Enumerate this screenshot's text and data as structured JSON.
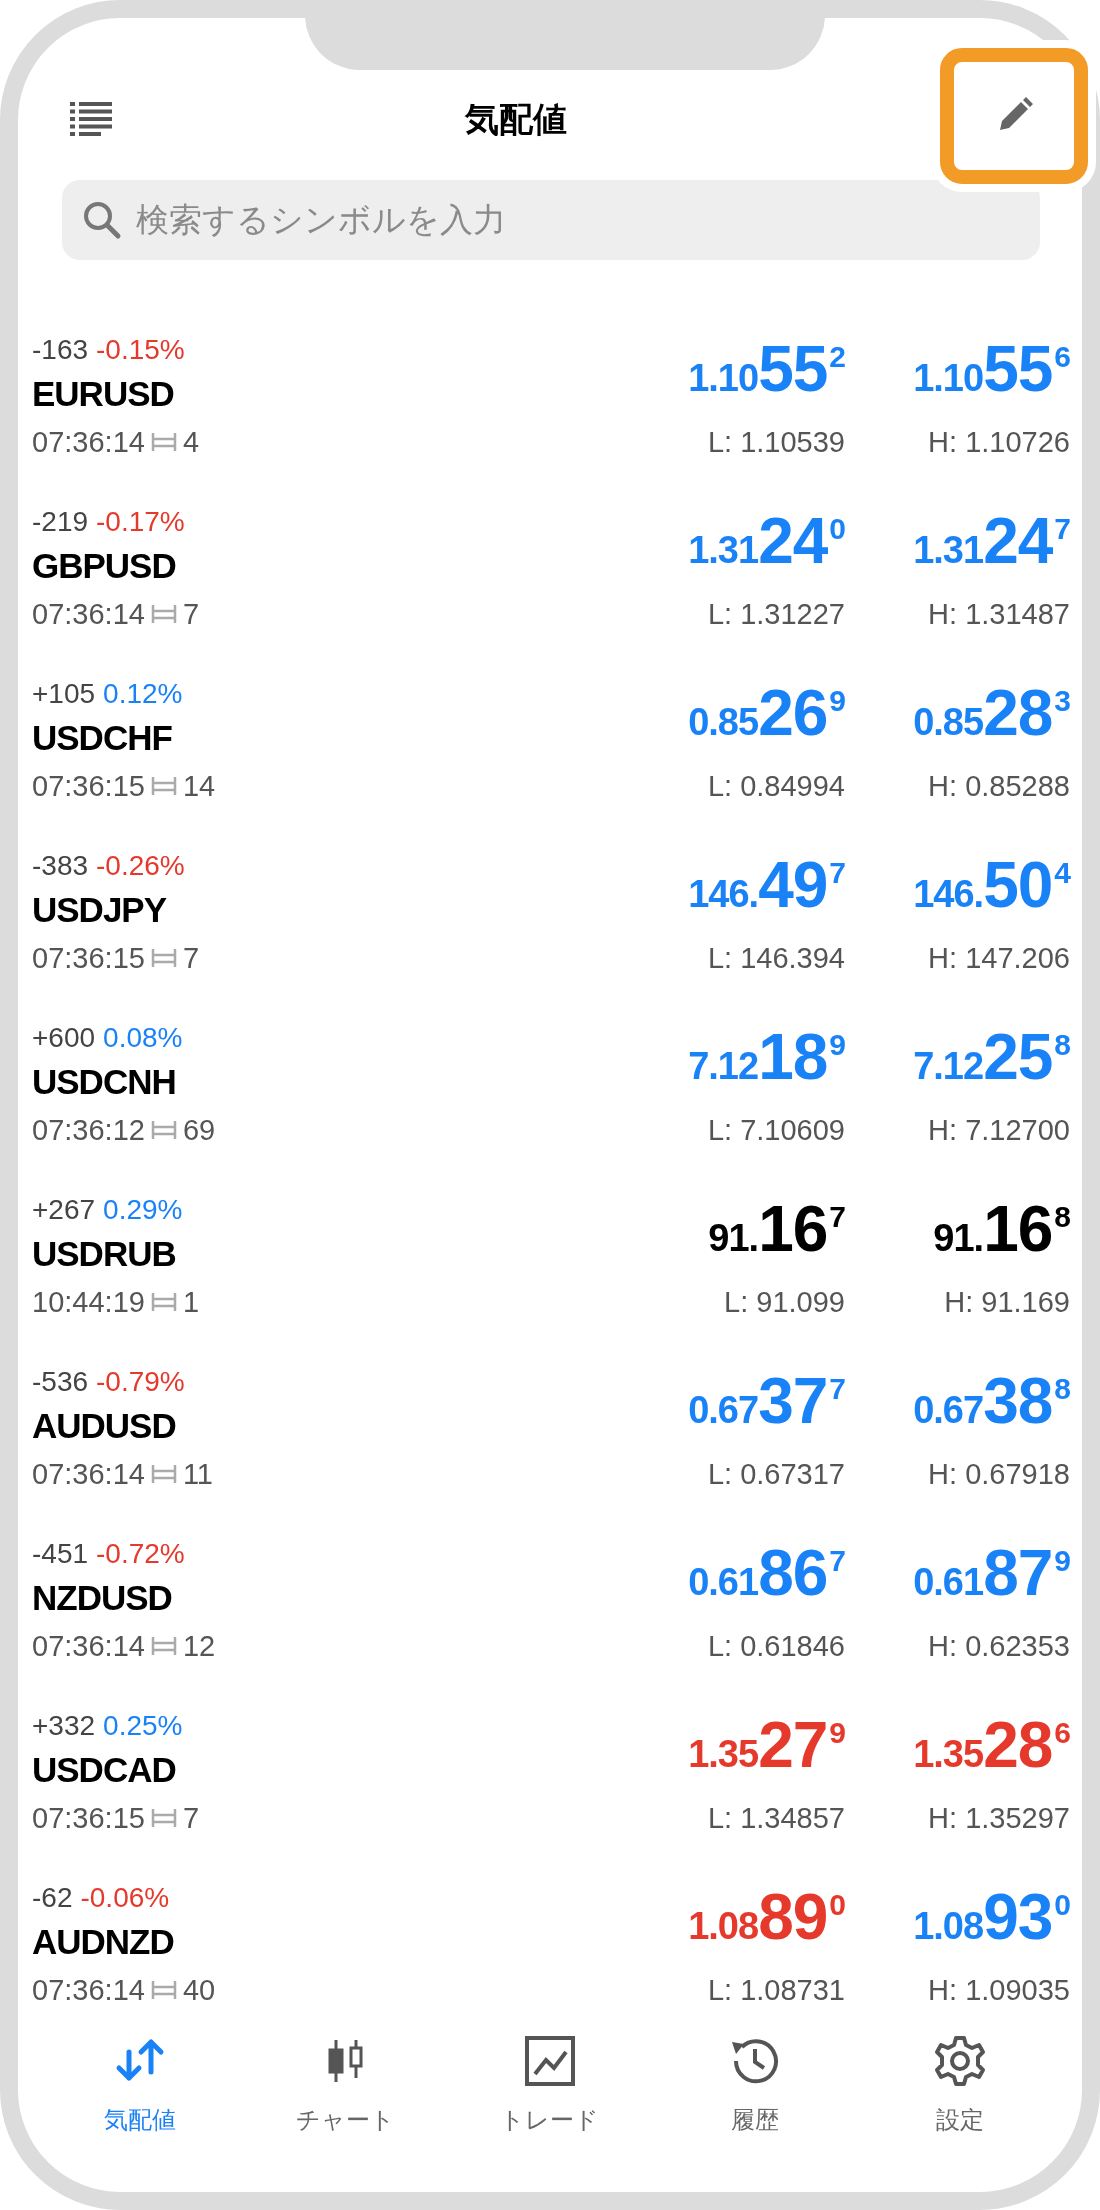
{
  "header": {
    "title": "気配値",
    "edit_button": {
      "highlighted": true
    }
  },
  "search": {
    "placeholder": "検索するシンボルを入力"
  },
  "quotes": [
    {
      "points": "-163",
      "percent": "-0.15%",
      "color": "#e5392c",
      "symbol": "EURUSD",
      "time": "07:36:14",
      "spread": "4",
      "bid": {
        "prefix": "1.10",
        "big": "55",
        "sup": "2",
        "color": "#1a82f7"
      },
      "ask": {
        "prefix": "1.10",
        "big": "55",
        "sup": "6",
        "color": "#1a82f7"
      },
      "low": "L: 1.10539",
      "high": "H: 1.10726"
    },
    {
      "points": "-219",
      "percent": "-0.17%",
      "color": "#e5392c",
      "symbol": "GBPUSD",
      "time": "07:36:14",
      "spread": "7",
      "bid": {
        "prefix": "1.31",
        "big": "24",
        "sup": "0",
        "color": "#1a82f7"
      },
      "ask": {
        "prefix": "1.31",
        "big": "24",
        "sup": "7",
        "color": "#1a82f7"
      },
      "low": "L: 1.31227",
      "high": "H: 1.31487"
    },
    {
      "points": "+105",
      "percent": "0.12%",
      "color": "#1a82f7",
      "symbol": "USDCHF",
      "time": "07:36:15",
      "spread": "14",
      "bid": {
        "prefix": "0.85",
        "big": "26",
        "sup": "9",
        "color": "#1a82f7"
      },
      "ask": {
        "prefix": "0.85",
        "big": "28",
        "sup": "3",
        "color": "#1a82f7"
      },
      "low": "L: 0.84994",
      "high": "H: 0.85288"
    },
    {
      "points": "-383",
      "percent": "-0.26%",
      "color": "#e5392c",
      "symbol": "USDJPY",
      "time": "07:36:15",
      "spread": "7",
      "bid": {
        "prefix": "146.",
        "big": "49",
        "sup": "7",
        "color": "#1a82f7"
      },
      "ask": {
        "prefix": "146.",
        "big": "50",
        "sup": "4",
        "color": "#1a82f7"
      },
      "low": "L: 146.394",
      "high": "H: 147.206"
    },
    {
      "points": "+600",
      "percent": "0.08%",
      "color": "#1a82f7",
      "symbol": "USDCNH",
      "time": "07:36:12",
      "spread": "69",
      "bid": {
        "prefix": "7.12",
        "big": "18",
        "sup": "9",
        "color": "#1a82f7"
      },
      "ask": {
        "prefix": "7.12",
        "big": "25",
        "sup": "8",
        "color": "#1a82f7"
      },
      "low": "L: 7.10609",
      "high": "H: 7.12700"
    },
    {
      "points": "+267",
      "percent": "0.29%",
      "color": "#1a82f7",
      "symbol": "USDRUB",
      "time": "10:44:19",
      "spread": "1",
      "bid": {
        "prefix": "91.",
        "big": "16",
        "sup": "7",
        "color": "#000000"
      },
      "ask": {
        "prefix": "91.",
        "big": "16",
        "sup": "8",
        "color": "#000000"
      },
      "low": "L: 91.099",
      "high": "H: 91.169"
    },
    {
      "points": "-536",
      "percent": "-0.79%",
      "color": "#e5392c",
      "symbol": "AUDUSD",
      "time": "07:36:14",
      "spread": "11",
      "bid": {
        "prefix": "0.67",
        "big": "37",
        "sup": "7",
        "color": "#1a82f7"
      },
      "ask": {
        "prefix": "0.67",
        "big": "38",
        "sup": "8",
        "color": "#1a82f7"
      },
      "low": "L: 0.67317",
      "high": "H: 0.67918"
    },
    {
      "points": "-451",
      "percent": "-0.72%",
      "color": "#e5392c",
      "symbol": "NZDUSD",
      "time": "07:36:14",
      "spread": "12",
      "bid": {
        "prefix": "0.61",
        "big": "86",
        "sup": "7",
        "color": "#1a82f7"
      },
      "ask": {
        "prefix": "0.61",
        "big": "87",
        "sup": "9",
        "color": "#1a82f7"
      },
      "low": "L: 0.61846",
      "high": "H: 0.62353"
    },
    {
      "points": "+332",
      "percent": "0.25%",
      "color": "#1a82f7",
      "symbol": "USDCAD",
      "time": "07:36:15",
      "spread": "7",
      "bid": {
        "prefix": "1.35",
        "big": "27",
        "sup": "9",
        "color": "#e5392c"
      },
      "ask": {
        "prefix": "1.35",
        "big": "28",
        "sup": "6",
        "color": "#e5392c"
      },
      "low": "L: 1.34857",
      "high": "H: 1.35297"
    },
    {
      "points": "-62",
      "percent": "-0.06%",
      "color": "#e5392c",
      "symbol": "AUDNZD",
      "time": "07:36:14",
      "spread": "40",
      "bid": {
        "prefix": "1.08",
        "big": "89",
        "sup": "0",
        "color": "#e5392c"
      },
      "ask": {
        "prefix": "1.08",
        "big": "93",
        "sup": "0",
        "color": "#1a82f7"
      },
      "low": "L: 1.08731",
      "high": "H: 1.09035"
    }
  ],
  "tab_bar": [
    {
      "kind": "quotes",
      "label": "気配値",
      "selected": true
    },
    {
      "kind": "chart",
      "label": "チャート",
      "selected": false
    },
    {
      "kind": "trade",
      "label": "トレード",
      "selected": false
    },
    {
      "kind": "history",
      "label": "履歴",
      "selected": false
    },
    {
      "kind": "settings",
      "label": "設定",
      "selected": false
    }
  ]
}
